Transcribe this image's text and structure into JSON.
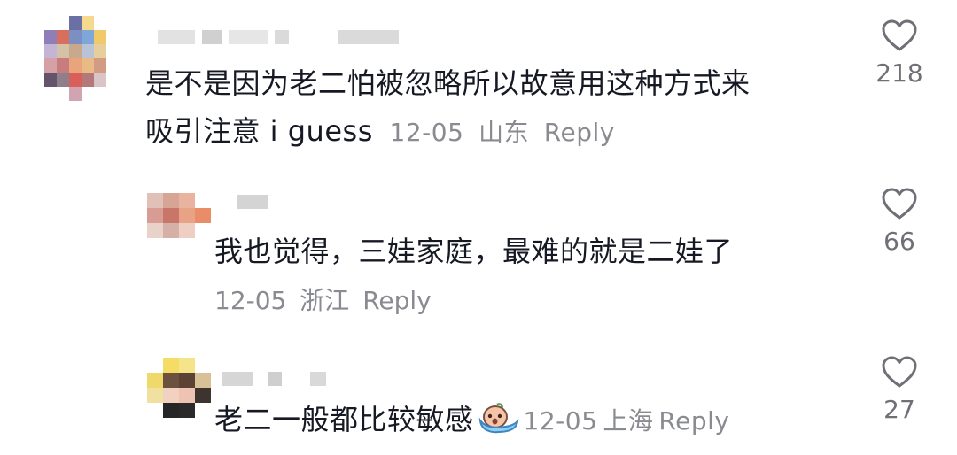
{
  "comments": [
    {
      "text_line1": "是不是因为老二怕被忽略所以故意用这种方式来",
      "text_line2": "吸引注意 i guess",
      "date": "12-05",
      "location": "山东",
      "reply_label": "Reply",
      "likes": "218",
      "avatar_icon": "pixelated-avatar-icon",
      "like_icon": "heart-outline-icon"
    },
    {
      "text": "我也觉得，三娃家庭，最难的就是二娃了",
      "date": "12-05",
      "location": "浙江",
      "reply_label": "Reply",
      "likes": "66",
      "avatar_icon": "pixelated-avatar-icon",
      "like_icon": "heart-outline-icon"
    },
    {
      "text": "老二一般都比较敏感",
      "emoji": "crying-face-emoji",
      "date": "12-05",
      "location": "上海",
      "reply_label": "Reply",
      "likes": "27",
      "avatar_icon": "pixelated-avatar-icon",
      "like_icon": "heart-outline-icon"
    }
  ],
  "colors": {
    "text": "#161823",
    "meta": "#8a8b91",
    "icon": "#6f7076"
  }
}
